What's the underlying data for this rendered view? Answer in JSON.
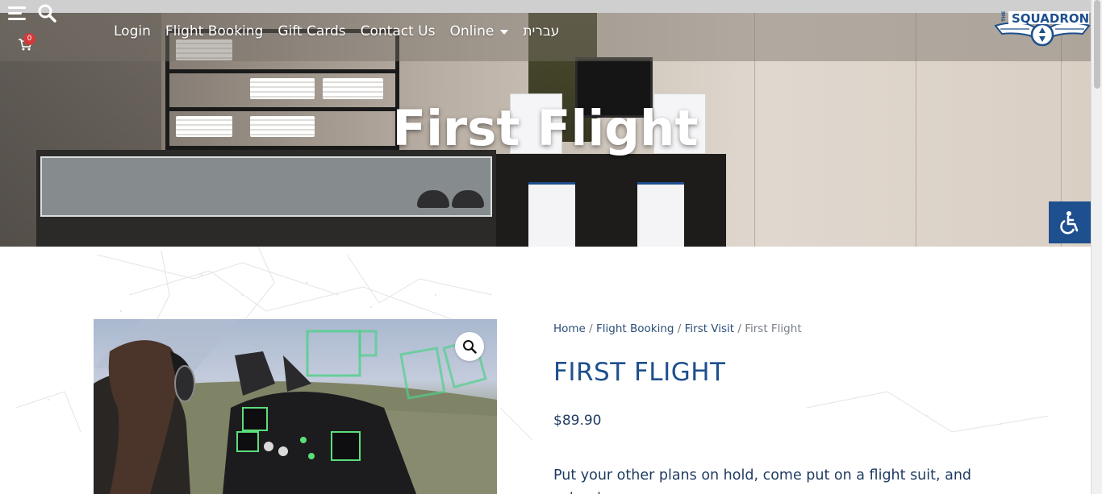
{
  "colors": {
    "brand_blue": "#1e4f8e",
    "title_text": "#ffffff",
    "cart_badge": "#d33a3a"
  },
  "header": {
    "menu_icon": "hamburger-menu-icon",
    "search_icon": "search-icon",
    "cart_icon": "cart-icon",
    "cart_count": "0",
    "nav": [
      {
        "label": "Login"
      },
      {
        "label": "Flight Booking"
      },
      {
        "label": "Gift Cards"
      },
      {
        "label": "Contact Us"
      },
      {
        "label": "Online",
        "has_dropdown": true
      },
      {
        "label": "עברית"
      }
    ],
    "logo": {
      "text": "SQUADRON",
      "prefix": "THE"
    }
  },
  "hero": {
    "title": "First Flight"
  },
  "accessibility": {
    "icon": "wheelchair-accessibility-icon"
  },
  "product": {
    "breadcrumb": [
      {
        "label": "Home"
      },
      {
        "label": "Flight Booking"
      },
      {
        "label": "First Visit"
      },
      {
        "label": "First Flight"
      }
    ],
    "title": "FIRST FLIGHT",
    "price": "$89.90",
    "description": "Put your other plans on hold, come put on a flight suit, and set out",
    "image_zoom_icon": "magnifier-zoom-icon"
  }
}
